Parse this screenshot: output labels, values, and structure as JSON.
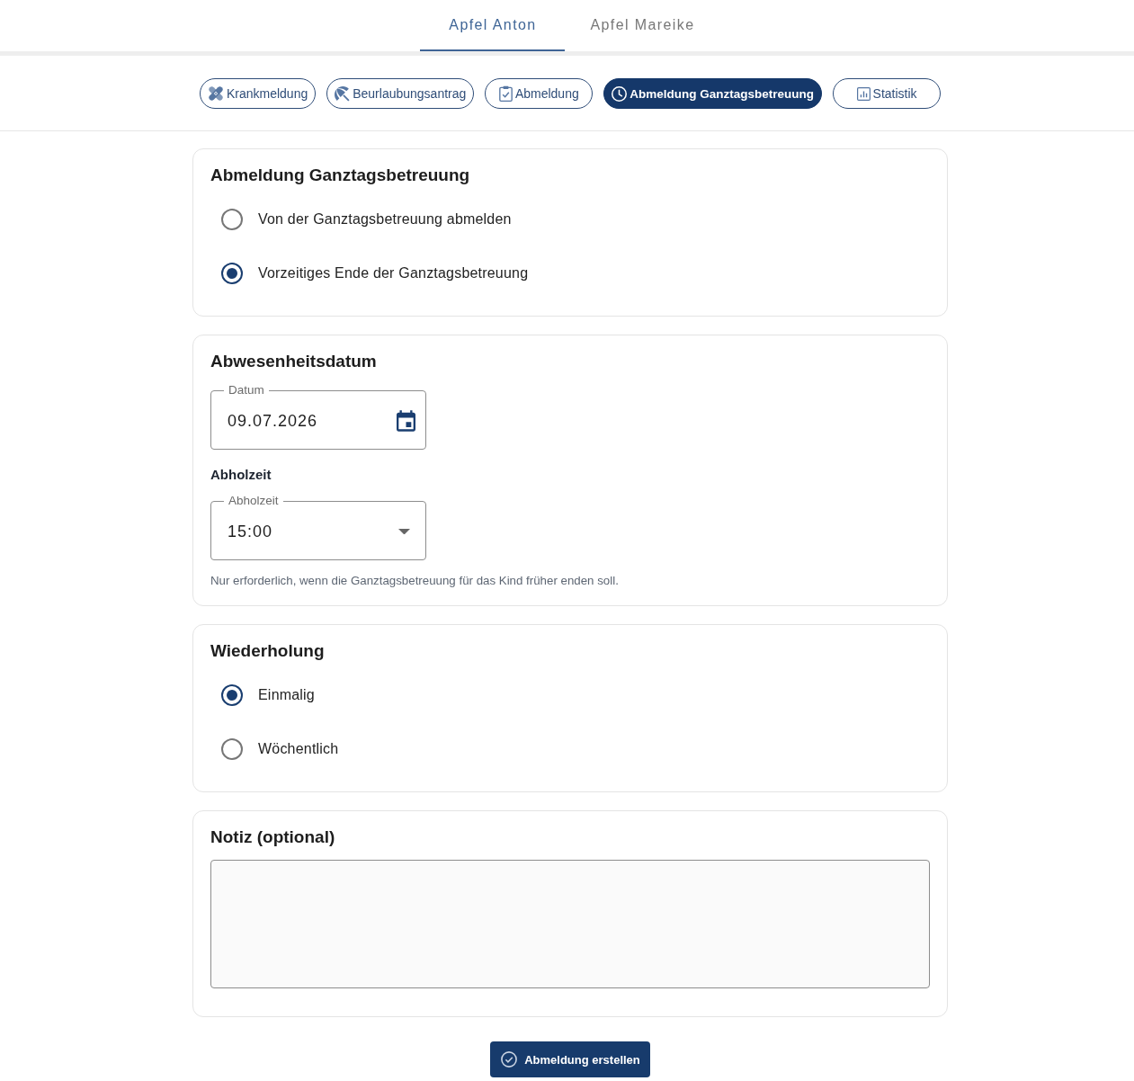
{
  "tabs": [
    {
      "label": "Apfel Anton",
      "selected": true
    },
    {
      "label": "Apfel Mareike",
      "selected": false
    }
  ],
  "categories": [
    {
      "label": "Krankmeldung",
      "selected": false
    },
    {
      "label": "Beurlaubungsantrag",
      "selected": false
    },
    {
      "label": "Abmeldung",
      "selected": false
    },
    {
      "label": "Abmeldung Ganztagsbetreuung",
      "selected": true
    },
    {
      "label": "Statistik",
      "selected": false
    }
  ],
  "sections": [
    {
      "kind": "radio",
      "title": "Abmeldung Ganztagsbetreuung",
      "options": [
        {
          "label": "Von der Ganztagsbetreuung abmelden",
          "selected": false
        },
        {
          "label": "Vorzeitiges Ende der Ganztagsbetreuung",
          "selected": true
        }
      ]
    },
    {
      "kind": "date_time",
      "title": "Abwesenheitsdatum",
      "date_field": {
        "label": "Datum",
        "value": "09.07.2026"
      },
      "subheading": "Abholzeit",
      "time_field": {
        "label": "Abholzeit",
        "value": "15:00"
      },
      "helper": "Nur erforderlich, wenn die Ganztagsbetreuung für das Kind früher enden soll."
    },
    {
      "kind": "radio",
      "title": "Wiederholung",
      "options": [
        {
          "label": "Einmalig",
          "selected": true
        },
        {
          "label": "Wöchentlich",
          "selected": false
        }
      ]
    },
    {
      "kind": "note",
      "title": "Notiz (optional)"
    }
  ],
  "submit_button": "Abmeldung erstellen"
}
